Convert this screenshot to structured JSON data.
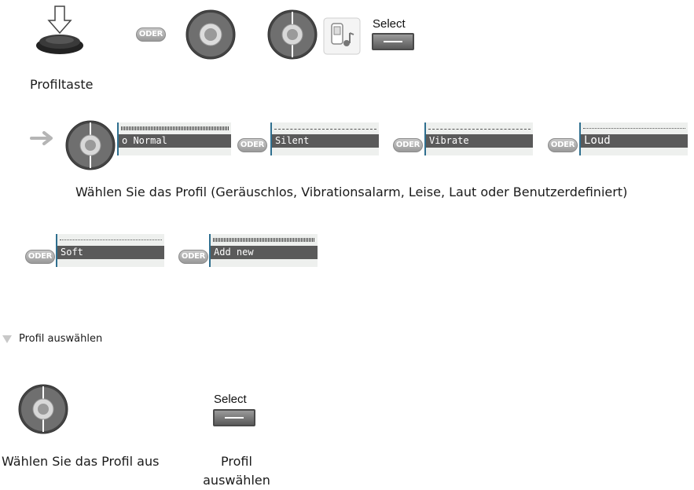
{
  "oder_label": "ODER",
  "select_label": "Select",
  "profile_key_caption": "Profiltaste",
  "display_items": [
    {
      "text": "o Normal",
      "top": "hatched"
    },
    {
      "text": "Silent",
      "top": "dashed"
    },
    {
      "text": "Vibrate",
      "top": "dashed"
    },
    {
      "text": "Loud",
      "top": "dotted"
    },
    {
      "text": "Soft",
      "top": "dotted"
    },
    {
      "text": "Add new",
      "top": "hatched"
    }
  ],
  "choose_profile_caption": "Wählen Sie das Profil (Geräuschlos, Vibrationsalarm, Leise, Laut oder Benutzerdefiniert)",
  "section_title": "Profil auswählen",
  "step_choose_caption": "Wählen Sie das Profil aus",
  "step_select_caption": "Profil auswählen",
  "colors": {
    "display_bar": "#5a5a5a",
    "display_bg": "#eef0ee",
    "display_edge": "#2f6f8f",
    "badge": "#a8a8a8"
  },
  "icons": [
    "down-arrow-icon",
    "profile-key-icon",
    "navigation-wheel-icon",
    "music-profile-icon",
    "right-arrow-icon",
    "triangle-bullet-icon"
  ]
}
